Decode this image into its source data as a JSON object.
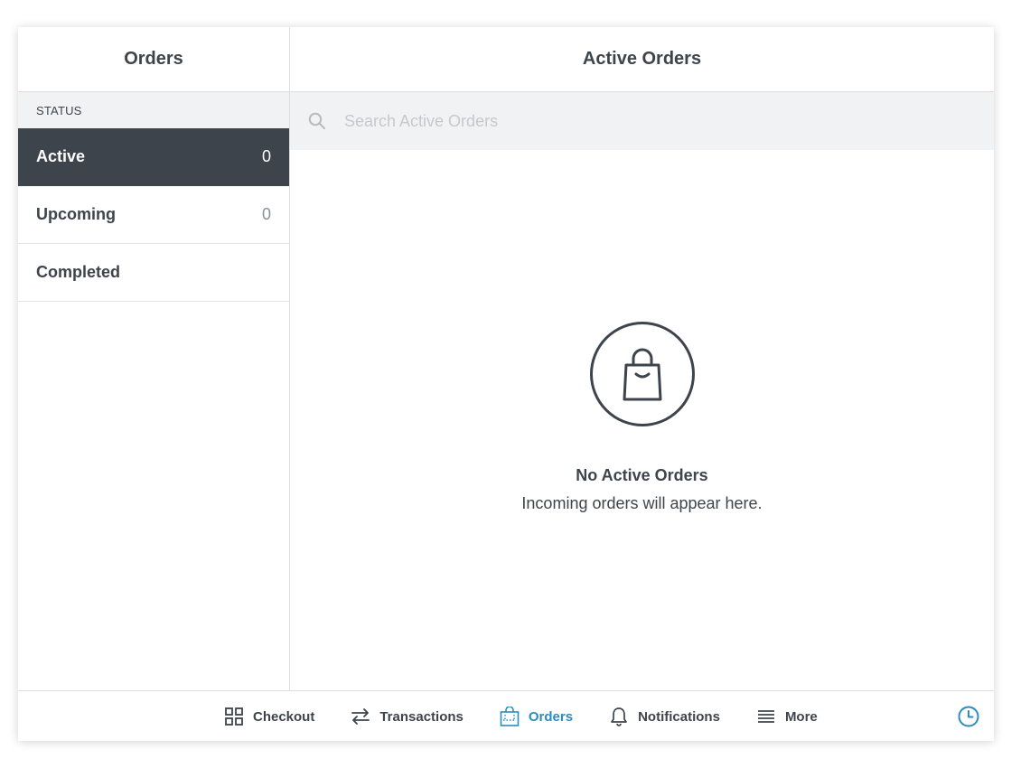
{
  "sidebar": {
    "title": "Orders",
    "section_label": "STATUS",
    "items": [
      {
        "label": "Active",
        "count": "0"
      },
      {
        "label": "Upcoming",
        "count": "0"
      },
      {
        "label": "Completed"
      }
    ]
  },
  "main": {
    "title": "Active Orders",
    "search": {
      "placeholder": "Search Active Orders",
      "value": ""
    },
    "empty": {
      "title": "No Active Orders",
      "subtitle": "Incoming orders will appear here."
    }
  },
  "nav": {
    "items": [
      {
        "label": "Checkout",
        "icon": "grid-icon"
      },
      {
        "label": "Transactions",
        "icon": "transfer-arrows-icon"
      },
      {
        "label": "Orders",
        "icon": "orders-bag-icon",
        "selected": true
      },
      {
        "label": "Notifications",
        "icon": "bell-icon"
      },
      {
        "label": "More",
        "icon": "menu-lines-icon"
      }
    ],
    "clock_icon": "clock-icon"
  },
  "colors": {
    "dark": "#3d444b",
    "accent": "#2a8cc0",
    "panel_bg": "#f1f2f3",
    "border": "#dcdee0"
  }
}
